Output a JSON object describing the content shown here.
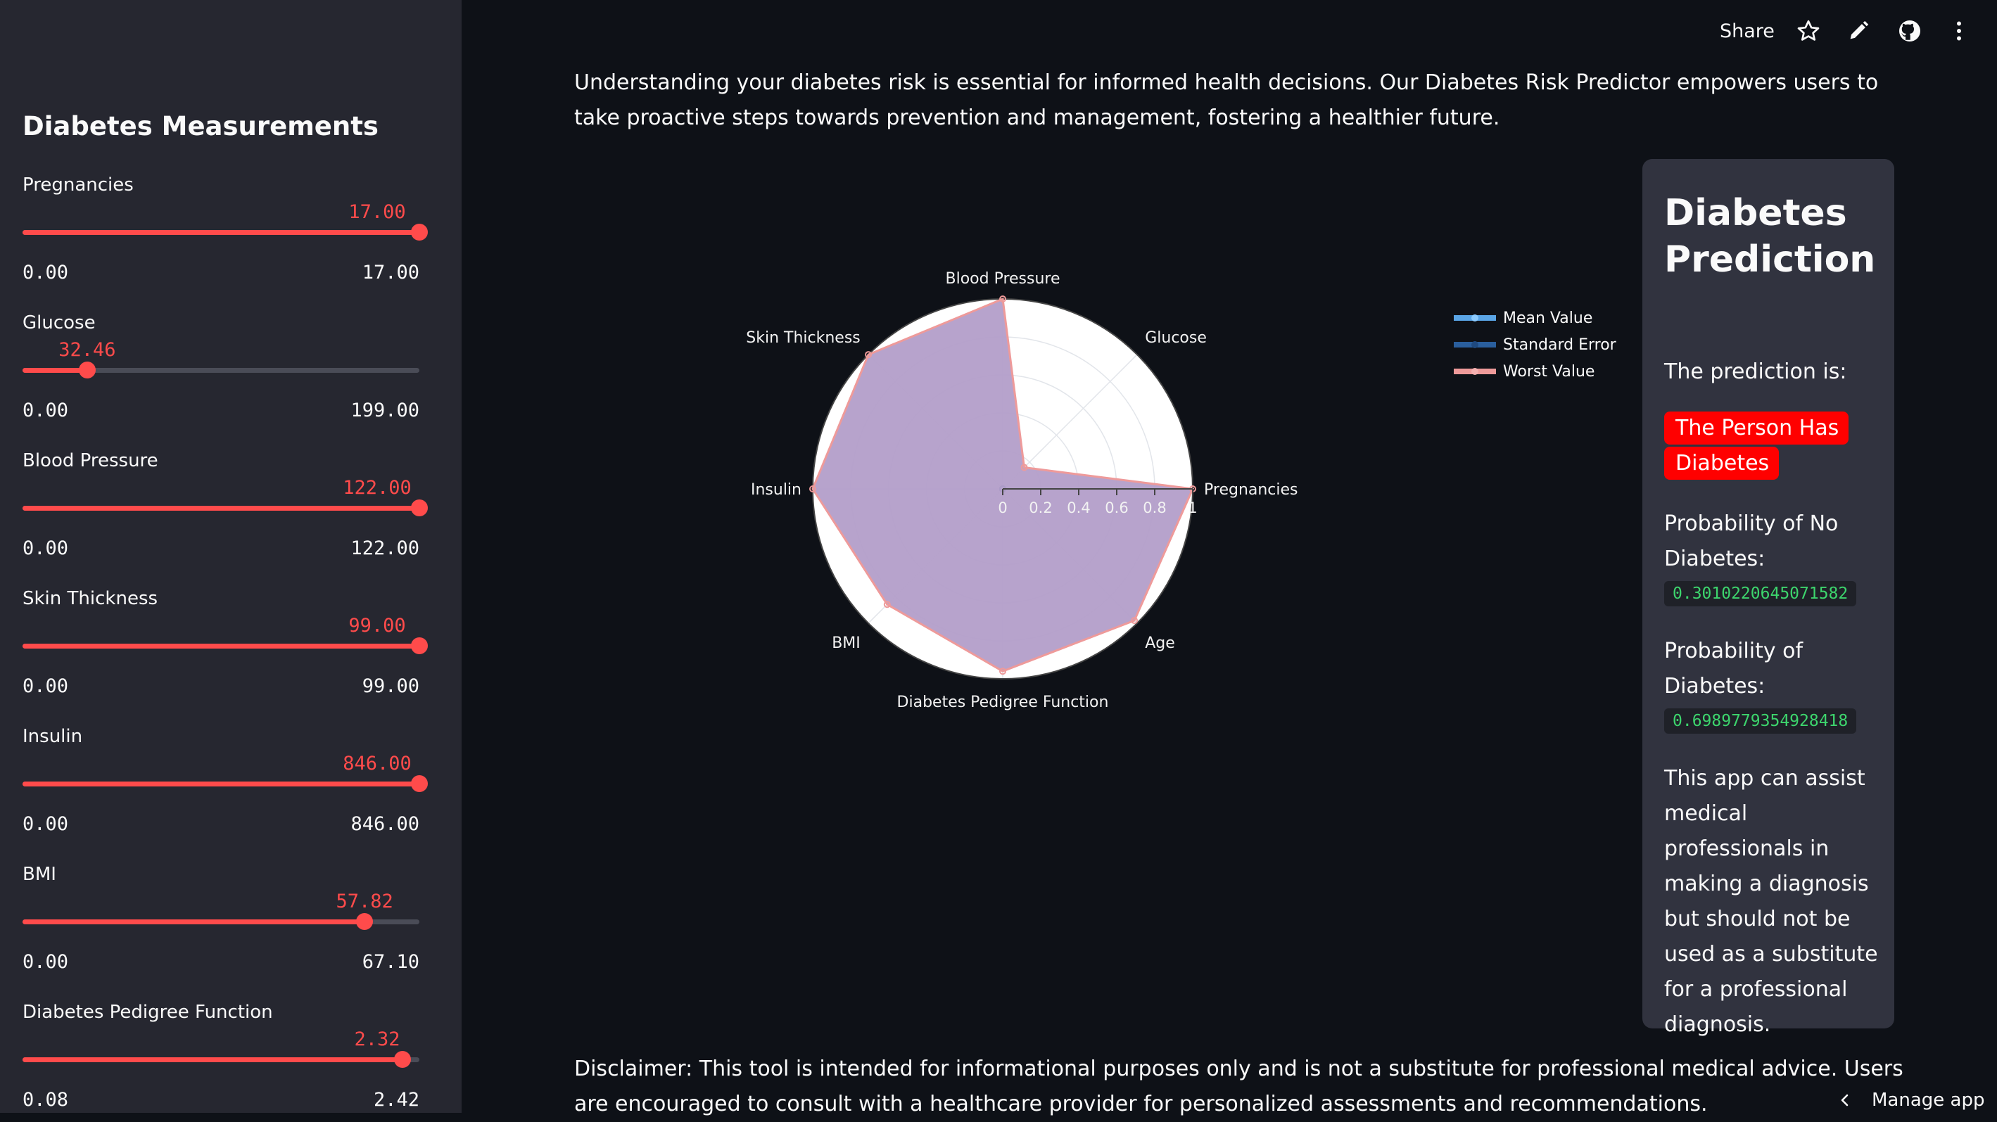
{
  "sidebar": {
    "title": "Diabetes Measurements",
    "sliders": [
      {
        "label": "Pregnancies",
        "value": "17.00",
        "min": "0.00",
        "max": "17.00",
        "fraction": 1.0
      },
      {
        "label": "Glucose",
        "value": "32.46",
        "min": "0.00",
        "max": "199.00",
        "fraction": 0.163
      },
      {
        "label": "Blood Pressure",
        "value": "122.00",
        "min": "0.00",
        "max": "122.00",
        "fraction": 1.0
      },
      {
        "label": "Skin Thickness",
        "value": "99.00",
        "min": "0.00",
        "max": "99.00",
        "fraction": 1.0
      },
      {
        "label": "Insulin",
        "value": "846.00",
        "min": "0.00",
        "max": "846.00",
        "fraction": 1.0
      },
      {
        "label": "BMI",
        "value": "57.82",
        "min": "0.00",
        "max": "67.10",
        "fraction": 0.862
      },
      {
        "label": "Diabetes Pedigree Function",
        "value": "2.32",
        "min": "0.08",
        "max": "2.42",
        "fraction": 0.957
      }
    ]
  },
  "toolbar": {
    "share_label": "Share",
    "icons": [
      "star-icon",
      "pencil-icon",
      "github-icon",
      "more-vertical-icon"
    ]
  },
  "main": {
    "intro": "Understanding your diabetes risk is essential for informed health decisions. Our Diabetes Risk Predictor empowers users to take proactive steps towards prevention and management, fostering a healthier future.",
    "disclaimer": "Disclaimer: This tool is intended for informational purposes only and is not a substitute for professional medical advice. Users are encouraged to consult with a healthcare provider for personalized assessments and recommendations."
  },
  "chart_data": {
    "type": "radar",
    "categories": [
      "Pregnancies",
      "Glucose",
      "Blood Pressure",
      "Skin Thickness",
      "Insulin",
      "BMI",
      "Diabetes Pedigree Function",
      "Age"
    ],
    "radial_ticks": [
      "0",
      "0.2",
      "0.4",
      "0.6",
      "0.8",
      "1"
    ],
    "radial_range": [
      0,
      1
    ],
    "grid": true,
    "legend_position": "right",
    "series": [
      {
        "name": "Mean Value",
        "color": "#5aa5e6",
        "values": [
          0,
          0,
          0,
          0,
          0,
          0,
          0,
          0
        ]
      },
      {
        "name": "Standard Error",
        "color": "#2a5f9e",
        "values": [
          0,
          0,
          0,
          0,
          0,
          0,
          0,
          0
        ]
      },
      {
        "name": "Worst Value",
        "color": "#ee9a9a",
        "fill": "#b39ec9",
        "values": [
          1.0,
          0.16,
          1.0,
          1.0,
          1.0,
          0.86,
          0.96,
          0.98
        ]
      }
    ]
  },
  "prediction": {
    "title": "Diabetes Prediction",
    "label": "The prediction is:",
    "result": "The Person Has Diabetes",
    "result_color": "#ff0000",
    "prob_no_label": "Probability of No Diabetes:",
    "prob_no_value": "0.3010220645071582",
    "prob_yes_label": "Probability of Diabetes:",
    "prob_yes_value": "0.6989779354928418",
    "note": "This app can assist medical professionals in making a diagnosis but should not be used as a substitute for a professional diagnosis."
  },
  "footer": {
    "manage_app_label": "Manage app"
  }
}
